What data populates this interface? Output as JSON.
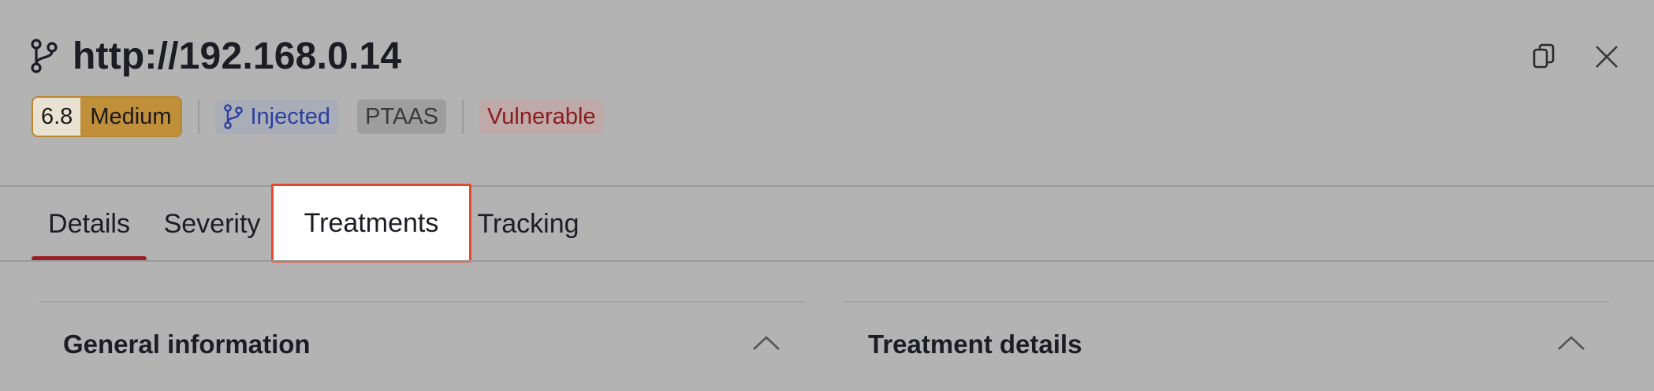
{
  "header": {
    "title": "http://192.168.0.14",
    "icons": {
      "title_icon": "git-branch-icon",
      "copy": "copy-icon",
      "close": "close-icon"
    }
  },
  "badges": {
    "severity_score": "6.8",
    "severity_level": "Medium",
    "status_injected": "Injected",
    "source": "PTAAS",
    "state": "Vulnerable"
  },
  "tabs": [
    {
      "label": "Details",
      "active": true
    },
    {
      "label": "Severity",
      "active": false
    },
    {
      "label": "Treatments",
      "active": false,
      "highlighted": true
    },
    {
      "label": "Tracking",
      "active": false
    }
  ],
  "sections": {
    "left_title": "General information",
    "right_title": "Treatment details"
  },
  "colors": {
    "active_tab_underline": "#9a1f24",
    "highlight_border": "#e5492d",
    "medium_severity": "#c08f3a",
    "injected_text": "#2b3fa0",
    "vulnerable_text": "#8c1c1c"
  }
}
